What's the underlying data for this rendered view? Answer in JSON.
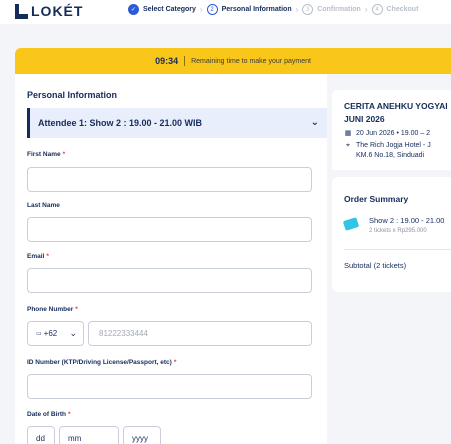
{
  "brand": {
    "name": "LOKÉT"
  },
  "steps": [
    {
      "num": "✓",
      "label": "Select Category",
      "state": "done"
    },
    {
      "num": "2",
      "label": "Personal Information",
      "state": "active"
    },
    {
      "num": "3",
      "label": "Confirmation",
      "state": "todo"
    },
    {
      "num": "4",
      "label": "Checkout",
      "state": "todo"
    }
  ],
  "timer": {
    "time": "09:34",
    "message": "Remaining time to make your payment"
  },
  "form": {
    "section_title": "Personal Information",
    "attendee": "Attendee 1: Show 2 : 19.00 - 21.00 WIB",
    "first_name_label": "First Name",
    "last_name_label": "Last Name",
    "email_label": "Email",
    "phone_label": "Phone Number",
    "phone_code": "+62",
    "phone_flag": "▭",
    "phone_placeholder": "81222333444",
    "id_label": "ID Number (KTP/Driving License/Passport, etc)",
    "dob_label": "Date of Birth",
    "dob_day": "dd",
    "dob_month": "mm",
    "dob_year": "yyyy",
    "required_mark": "*"
  },
  "event": {
    "title_line1": "CERITA ANEHKU YOGYAI",
    "title_line2": "JUNI 2026",
    "date": "20 Jun 2026 • 19.00 – 2",
    "venue_line1": "The Rich Jogja Hotel - J",
    "venue_line2": "KM.6 No.18, Sinduadi"
  },
  "summary": {
    "title": "Order Summary",
    "ticket_name": "Show 2 : 19.00 - 21.00",
    "ticket_qty": "2 tickets x Rp295.000",
    "subtotal_label": "Subtotal (2 tickets)"
  },
  "colors": {
    "primary": "#152c5b",
    "accent": "#2d5bd7",
    "banner": "#f8c71a",
    "required": "#e0393e"
  }
}
